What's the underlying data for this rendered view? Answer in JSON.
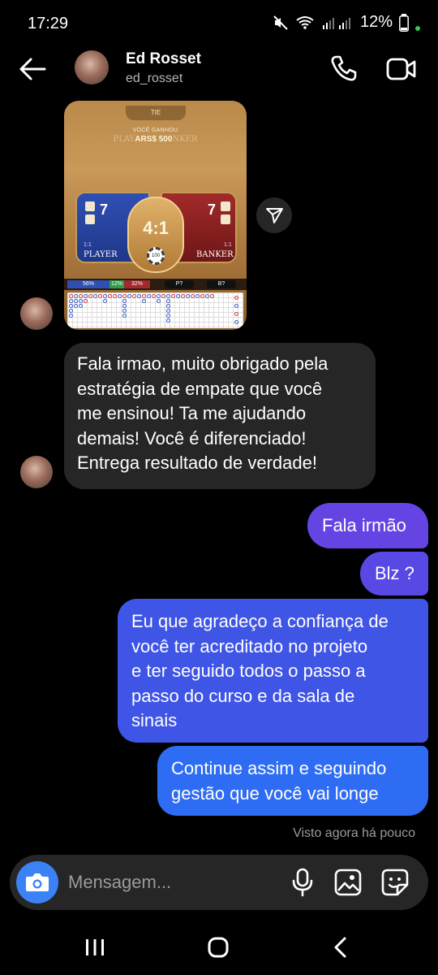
{
  "status_bar": {
    "time": "17:29",
    "battery": "12%"
  },
  "header": {
    "name": "Ed Rosset",
    "username": "ed_rosset"
  },
  "game_image": {
    "tab_label": "TIE",
    "won_text": "VOCÊ GANHOU",
    "bg_left_text": "PLAY",
    "amount": "ARS$ 500",
    "bg_right_text": "NKER",
    "player_score": "7",
    "banker_score": "7",
    "player_ratio": "1:1",
    "banker_ratio": "1:1",
    "player_label": "PLAYER",
    "banker_label": "BANKER",
    "tie_ratio": "4:1",
    "chip_value": "100",
    "stat_player": "56%",
    "stat_tie": "12%",
    "stat_banker": "32%",
    "stat_p_label": "P?",
    "stat_b_label": "B?"
  },
  "messages": {
    "incoming": "Fala irmao, muito obrigado pela\nestratégia de empate que você\nme ensinou! Ta me ajudando\ndemais! Você é diferenciado!\nEntrega resultado de verdade!",
    "out_1": "Fala irmão",
    "out_2": "Blz ?",
    "out_3": "Eu que agradeço a confiança de\nvocê ter acreditado no projeto\ne ter seguido todos o passo a\npasso do curso e da sala de\nsinais",
    "out_4": "Continue assim e seguindo\ngestão que você vai longe"
  },
  "seen_status": "Visto agora há pouco",
  "composer": {
    "placeholder": "Mensagem..."
  },
  "colors": {
    "bubble_in": "#262626",
    "bubble_out_top": "#6445e4",
    "bubble_out_bottom": "#2e6df3",
    "camera": "#3b82f6"
  },
  "icons": [
    "back-arrow-icon",
    "phone-icon",
    "video-icon",
    "share-icon",
    "camera-icon",
    "mic-icon",
    "gallery-icon",
    "sticker-icon"
  ]
}
